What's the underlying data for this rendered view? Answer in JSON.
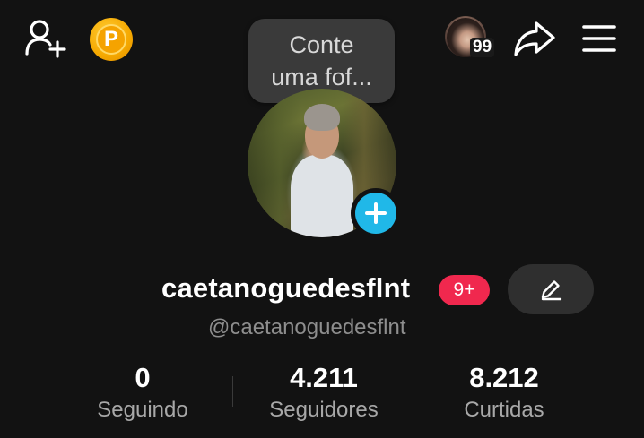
{
  "header": {
    "add_friend_icon": "add-user-icon",
    "coin_icon": "coin-icon",
    "coin_letter": "P",
    "viewer_count": "99",
    "share_icon": "share-icon",
    "menu_icon": "menu-icon"
  },
  "tooltip": {
    "line1": "Conte",
    "line2": "uma fof..."
  },
  "profile": {
    "username": "caetanoguedesflnt",
    "badge": "9+",
    "handle": "@caetanoguedesflnt",
    "add_story_icon": "plus-icon",
    "edit_icon": "pencil-icon"
  },
  "stats": [
    {
      "value": "0",
      "label": "Seguindo"
    },
    {
      "value": "4.211",
      "label": "Seguidores"
    },
    {
      "value": "8.212",
      "label": "Curtidas"
    }
  ],
  "colors": {
    "background": "#121212",
    "badge": "#f0284e",
    "add_story": "#20b8e8",
    "coin": "#f5a800"
  }
}
